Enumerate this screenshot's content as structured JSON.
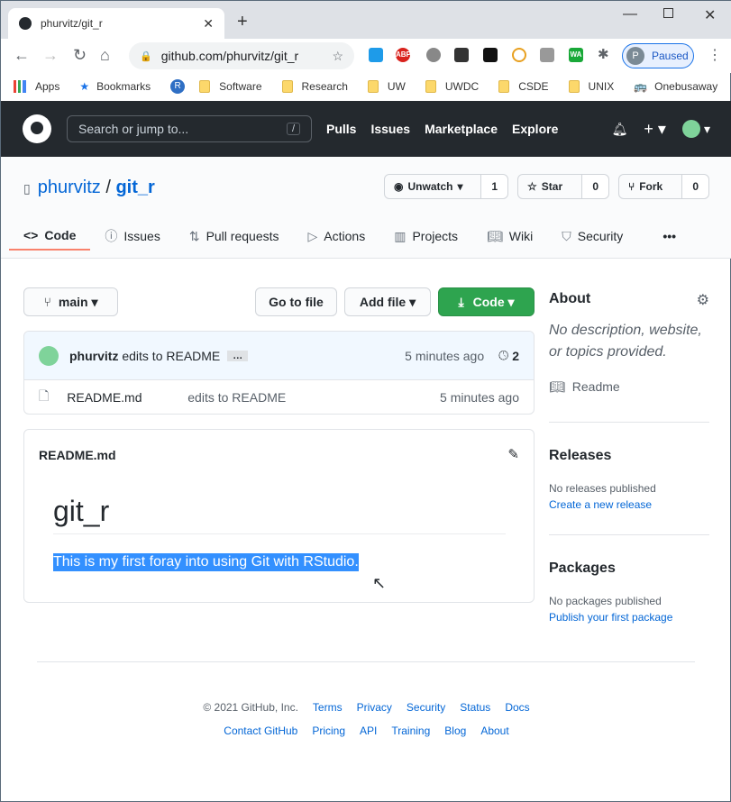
{
  "browser": {
    "tab_title": "phurvitz/git_r",
    "url": "github.com/phurvitz/git_r",
    "profile_initial": "P",
    "profile_status": "Paused",
    "bookmarks": [
      "Apps",
      "Bookmarks",
      "Software",
      "Research",
      "UW",
      "UWDC",
      "CSDE",
      "UNIX",
      "Onebusaway"
    ],
    "extensions": [
      "ABP",
      "WA"
    ]
  },
  "header": {
    "search_placeholder": "Search or jump to...",
    "slash": "/",
    "nav": [
      "Pulls",
      "Issues",
      "Marketplace",
      "Explore"
    ]
  },
  "repo": {
    "owner": "phurvitz",
    "sep": "/",
    "name": "git_r",
    "unwatch": "Unwatch",
    "watch_count": "1",
    "star": "Star",
    "star_count": "0",
    "fork": "Fork",
    "fork_count": "0",
    "tabs": [
      "Code",
      "Issues",
      "Pull requests",
      "Actions",
      "Projects",
      "Wiki",
      "Security"
    ]
  },
  "toolbar": {
    "branch": "main",
    "go_to_file": "Go to file",
    "add_file": "Add file",
    "code": "Code"
  },
  "commit": {
    "author": "phurvitz",
    "message": "edits to README",
    "ellipsis": "…",
    "time": "5 minutes ago",
    "count": "2"
  },
  "files": [
    {
      "name": "README.md",
      "message": "edits to README",
      "time": "5 minutes ago"
    }
  ],
  "readme": {
    "filename": "README.md",
    "title": "git_r",
    "body": "This is my first foray into using Git with RStudio."
  },
  "about": {
    "title": "About",
    "description": "No description, website, or topics provided.",
    "readme": "Readme"
  },
  "releases": {
    "title": "Releases",
    "none": "No releases published",
    "create": "Create a new release"
  },
  "packages": {
    "title": "Packages",
    "none": "No packages published",
    "publish": "Publish your first package"
  },
  "footer": {
    "copyright": "© 2021 GitHub, Inc.",
    "row1": [
      "Terms",
      "Privacy",
      "Security",
      "Status",
      "Docs"
    ],
    "row2": [
      "Contact GitHub",
      "Pricing",
      "API",
      "Training",
      "Blog",
      "About"
    ]
  }
}
